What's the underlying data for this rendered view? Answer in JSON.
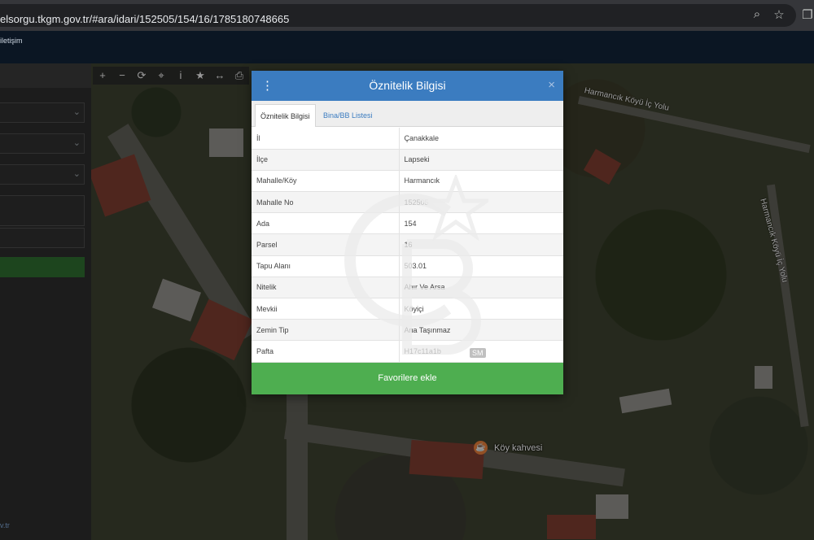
{
  "browser": {
    "url": "elsorgu.tkgm.gov.tr/#ara/idari/152505/154/16/1785180748665",
    "icons": [
      "zoom-icon",
      "star-icon",
      "extensions-icon"
    ]
  },
  "site_header": {
    "link": "iletişim"
  },
  "left_panel": {
    "footer": "v.tr"
  },
  "map": {
    "toolbar": [
      {
        "name": "zoom-in-icon",
        "glyph": "+"
      },
      {
        "name": "zoom-out-icon",
        "glyph": "−"
      },
      {
        "name": "refresh-icon",
        "glyph": "⟳"
      },
      {
        "name": "locate-icon",
        "glyph": "⌖"
      },
      {
        "name": "info-icon",
        "glyph": "i"
      },
      {
        "name": "star-icon",
        "glyph": "★"
      },
      {
        "name": "measure-icon",
        "glyph": "↔"
      },
      {
        "name": "print-icon",
        "glyph": "⎙"
      }
    ],
    "road_label_1": "Harmancık Köyü İç Yolu",
    "road_label_2": "Harmancık Köyü İç Yolu",
    "place_label": "Köy kahvesi"
  },
  "modal": {
    "title": "Öznitelik Bilgisi",
    "close_glyph": "×",
    "tabs": [
      "Öznitelik Bilgisi",
      "Bina/BB Listesi"
    ],
    "rows": [
      {
        "key": "İl",
        "value": "Çanakkale"
      },
      {
        "key": "İlçe",
        "value": "Lapseki"
      },
      {
        "key": "Mahalle/Köy",
        "value": "Harmancık"
      },
      {
        "key": "Mahalle No",
        "value": "152505"
      },
      {
        "key": "Ada",
        "value": "154"
      },
      {
        "key": "Parsel",
        "value": "16"
      },
      {
        "key": "Tapu Alanı",
        "value": "503.01"
      },
      {
        "key": "Nitelik",
        "value": "Ahır Ve Arsa"
      },
      {
        "key": "Mevkii",
        "value": "Köyiçi"
      },
      {
        "key": "Zemin Tip",
        "value": "Ana Taşınmaz"
      },
      {
        "key": "Pafta",
        "value": "H17c11a1b"
      }
    ],
    "favorite_button": "Favorilere ekle"
  },
  "watermark": {
    "badge": "SM"
  }
}
